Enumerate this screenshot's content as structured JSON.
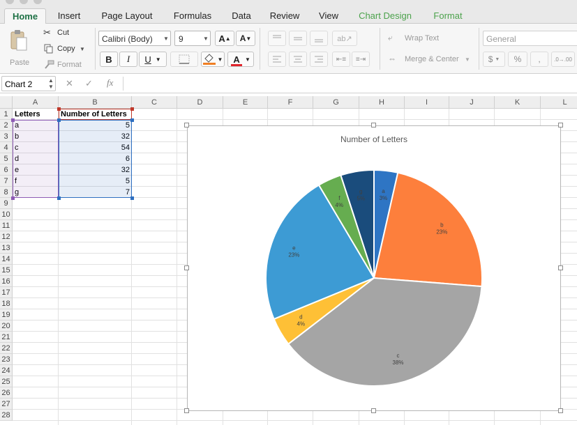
{
  "ribbon_tabs": [
    {
      "label": "Home",
      "active": true
    },
    {
      "label": "Insert"
    },
    {
      "label": "Page Layout"
    },
    {
      "label": "Formulas"
    },
    {
      "label": "Data"
    },
    {
      "label": "Review"
    },
    {
      "label": "View"
    },
    {
      "label": "Chart Design",
      "contextual": true
    },
    {
      "label": "Format",
      "contextual": true
    }
  ],
  "clipboard": {
    "paste": "Paste",
    "cut": "Cut",
    "copy": "Copy",
    "format": "Format"
  },
  "font": {
    "name": "Calibri (Body)",
    "size": "9",
    "bold": "B",
    "italic": "I",
    "underline": "U",
    "grow": "A",
    "shrink": "A",
    "color_letter": "A",
    "fill_color": "#f07f24",
    "font_color": "#e0242c"
  },
  "alignment": {
    "wrap_text": "Wrap Text",
    "merge_center": "Merge & Center"
  },
  "number": {
    "format": "General",
    "currency": "$",
    "percent": "%",
    "comma": ",",
    "decimals": ".0→.00"
  },
  "formula_bar": {
    "name_box": "Chart 2",
    "cancel": "✕",
    "enter": "✓",
    "fx": "fx",
    "value": ""
  },
  "sheet": {
    "columns": [
      "A",
      "B",
      "C",
      "D",
      "E",
      "F",
      "G",
      "H",
      "I",
      "J",
      "K",
      "L"
    ],
    "rows": [
      "1",
      "2",
      "3",
      "4",
      "5",
      "6",
      "7",
      "8",
      "9",
      "10",
      "11",
      "12",
      "13",
      "14",
      "15",
      "16",
      "17",
      "18",
      "19",
      "20",
      "21",
      "22",
      "23",
      "24",
      "25",
      "26",
      "27",
      "28"
    ],
    "header": [
      "Letters",
      "Number of Letters"
    ],
    "data": [
      [
        "a",
        "5"
      ],
      [
        "b",
        "32"
      ],
      [
        "c",
        "54"
      ],
      [
        "d",
        "6"
      ],
      [
        "e",
        "32"
      ],
      [
        "f",
        "5"
      ],
      [
        "g",
        "7"
      ]
    ]
  },
  "chart_data": {
    "type": "pie",
    "title": "Number of Letters",
    "categories": [
      "a",
      "b",
      "c",
      "d",
      "e",
      "f",
      "g"
    ],
    "values": [
      5,
      32,
      54,
      6,
      32,
      5,
      7
    ],
    "percent_labels": [
      "3%",
      "23%",
      "38%",
      "4%",
      "23%",
      "4%",
      "5%"
    ],
    "colors": [
      "#2e75c4",
      "#fd7f3c",
      "#a5a5a5",
      "#fec036",
      "#3d9bd4",
      "#66ad50",
      "#1a4c7c"
    ],
    "legend": "none"
  }
}
